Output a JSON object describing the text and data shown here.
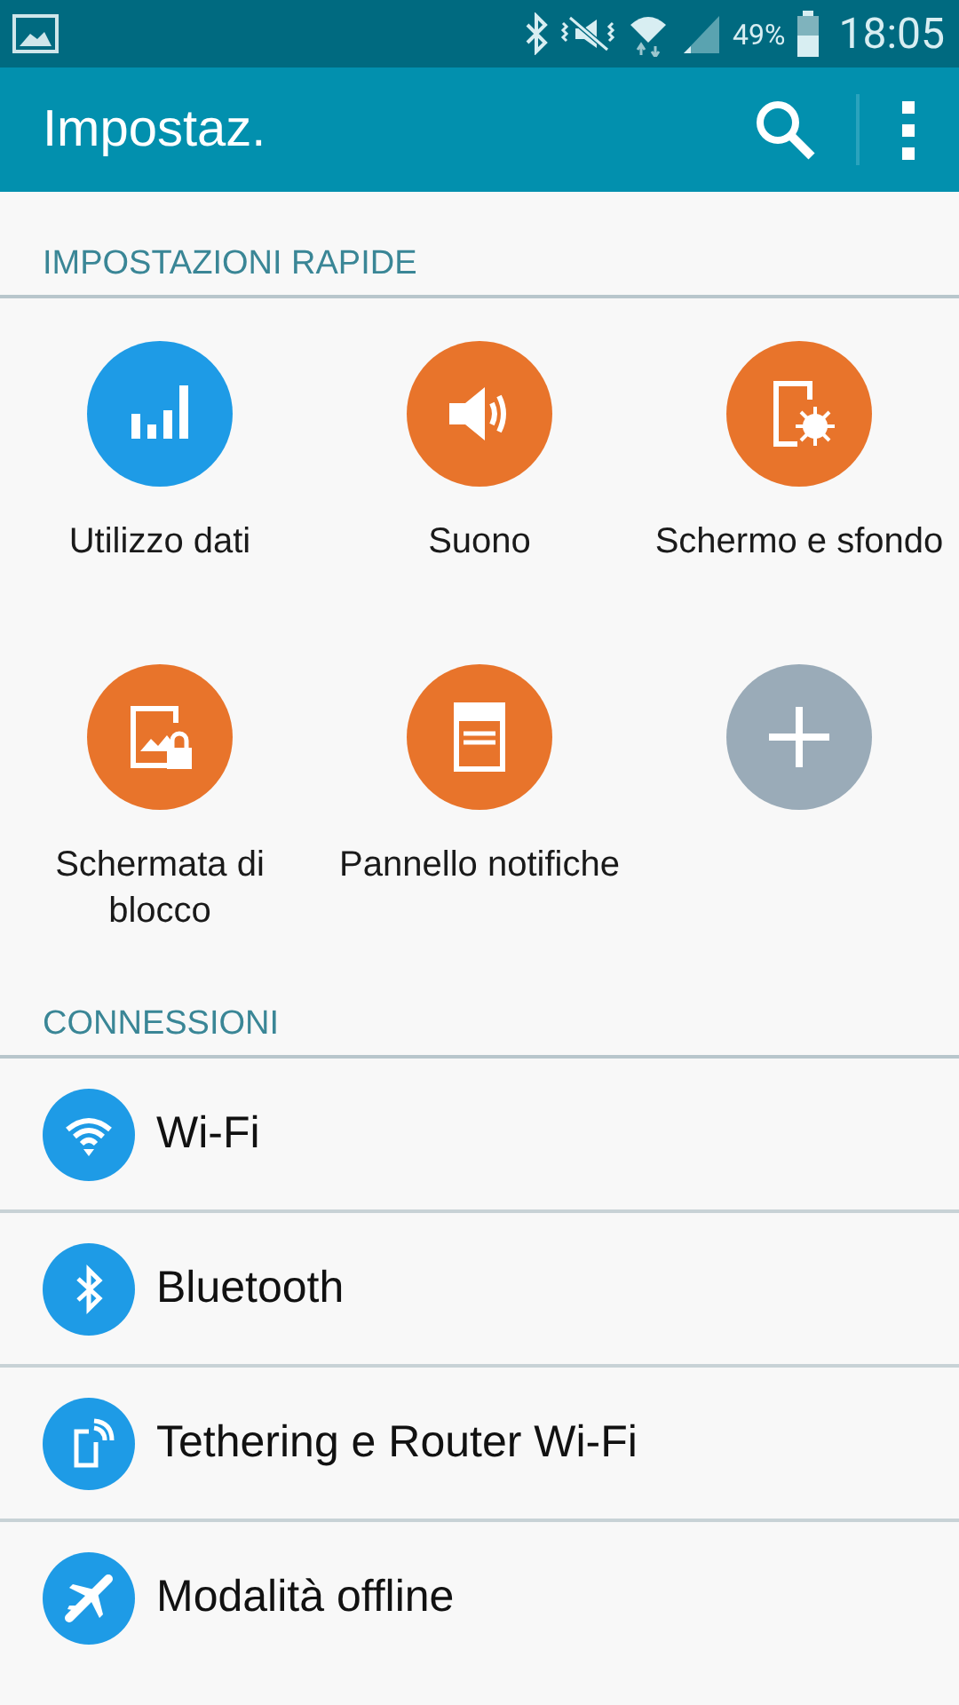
{
  "status_bar": {
    "battery_text": "49%",
    "time": "18:05"
  },
  "app_bar": {
    "title": "Impostaz."
  },
  "quick_settings": {
    "header": "IMPOSTAZIONI RAPIDE",
    "tiles": [
      {
        "label": "Utilizzo dati",
        "color": "#1e9be6"
      },
      {
        "label": "Suono",
        "color": "#e8742b"
      },
      {
        "label": "Schermo e sfondo",
        "color": "#e8742b"
      },
      {
        "label": "Schermata di blocco",
        "color": "#e8742b"
      },
      {
        "label": "Pannello notifiche",
        "color": "#e8742b"
      },
      {
        "kind": "add",
        "color": "#9aabb8"
      }
    ]
  },
  "connections": {
    "header": "CONNESSIONI",
    "items": [
      {
        "label": "Wi-Fi"
      },
      {
        "label": "Bluetooth"
      },
      {
        "label": "Tethering e Router Wi-Fi"
      },
      {
        "label": "Modalità offline"
      }
    ]
  }
}
